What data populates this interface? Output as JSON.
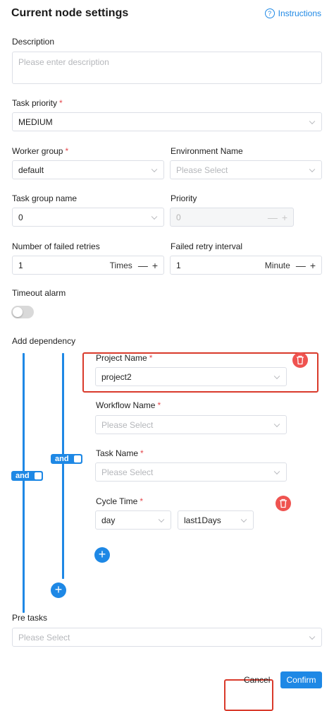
{
  "header": {
    "title": "Current node settings",
    "help_label": "Instructions"
  },
  "description": {
    "label": "Description",
    "placeholder": "Please enter description"
  },
  "task_priority": {
    "label": "Task priority",
    "value": "MEDIUM"
  },
  "worker_group": {
    "label": "Worker group",
    "value": "default"
  },
  "environment": {
    "label": "Environment Name",
    "placeholder": "Please Select"
  },
  "task_group": {
    "label": "Task group name",
    "value": "0"
  },
  "priority": {
    "label": "Priority",
    "value": "0"
  },
  "retries": {
    "label": "Number of failed retries",
    "value": "1",
    "unit": "Times"
  },
  "retry_interval": {
    "label": "Failed retry interval",
    "value": "1",
    "unit": "Minute"
  },
  "timeout": {
    "label": "Timeout alarm"
  },
  "dependency": {
    "label": "Add dependency",
    "outer_relation": "and",
    "inner_relation": "and",
    "project": {
      "label": "Project Name",
      "value": "project2"
    },
    "workflow": {
      "label": "Workflow Name",
      "placeholder": "Please Select"
    },
    "task": {
      "label": "Task Name",
      "placeholder": "Please Select"
    },
    "cycle": {
      "label": "Cycle Time",
      "unit": "day",
      "range": "last1Days"
    }
  },
  "pre_tasks": {
    "label": "Pre tasks",
    "placeholder": "Please Select"
  },
  "footer": {
    "cancel": "Cancel",
    "confirm": "Confirm"
  },
  "steppers": {
    "minus": "—",
    "plus": "+"
  },
  "colors": {
    "accent": "#1e88e5",
    "danger": "#ef5350",
    "highlight": "#d93a2b"
  }
}
